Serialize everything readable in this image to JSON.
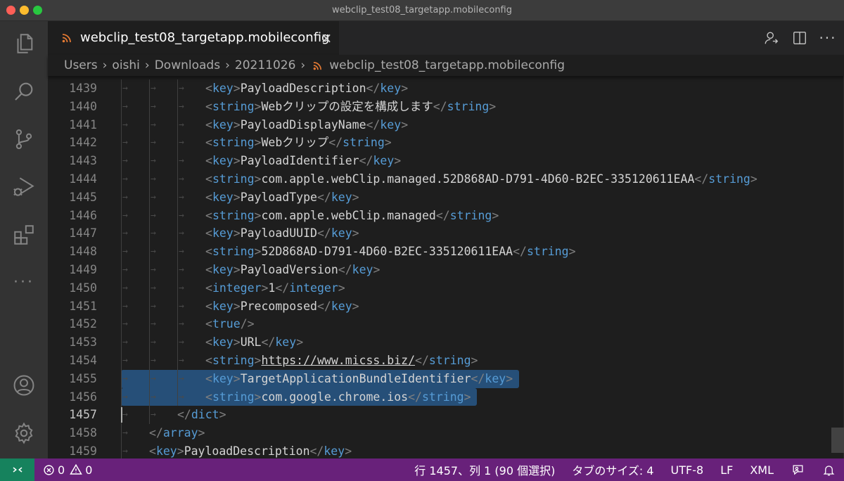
{
  "window": {
    "title": "webclip_test08_targetapp.mobileconfig"
  },
  "activity_bar": {
    "items": [
      {
        "name": "explorer",
        "icon": "files-icon"
      },
      {
        "name": "search",
        "icon": "search-icon"
      },
      {
        "name": "source-control",
        "icon": "source-control-icon"
      },
      {
        "name": "run-and-debug",
        "icon": "run-debug-icon"
      },
      {
        "name": "extensions",
        "icon": "extensions-icon"
      },
      {
        "name": "more",
        "icon": "more-icon"
      },
      {
        "name": "accounts",
        "icon": "account-icon"
      },
      {
        "name": "manage",
        "icon": "gear-icon"
      }
    ]
  },
  "tab": {
    "label": "webclip_test08_targetapp.mobileconfig",
    "close": "×"
  },
  "breadcrumb": [
    "Users",
    "oishi",
    "Downloads",
    "20211026",
    "webclip_test08_targetapp.mobileconfig"
  ],
  "editor": {
    "lines": [
      {
        "n": "1439",
        "indent": 3,
        "seg": [
          [
            "p",
            "<"
          ],
          [
            "t",
            "key"
          ],
          [
            "p",
            ">"
          ],
          [
            "v",
            "PayloadDescription"
          ],
          [
            "p",
            "</"
          ],
          [
            "t",
            "key"
          ],
          [
            "p",
            ">"
          ]
        ]
      },
      {
        "n": "1440",
        "indent": 3,
        "seg": [
          [
            "p",
            "<"
          ],
          [
            "t",
            "string"
          ],
          [
            "p",
            ">"
          ],
          [
            "v",
            "Webクリップの設定を構成します"
          ],
          [
            "p",
            "</"
          ],
          [
            "t",
            "string"
          ],
          [
            "p",
            ">"
          ]
        ]
      },
      {
        "n": "1441",
        "indent": 3,
        "seg": [
          [
            "p",
            "<"
          ],
          [
            "t",
            "key"
          ],
          [
            "p",
            ">"
          ],
          [
            "v",
            "PayloadDisplayName"
          ],
          [
            "p",
            "</"
          ],
          [
            "t",
            "key"
          ],
          [
            "p",
            ">"
          ]
        ]
      },
      {
        "n": "1442",
        "indent": 3,
        "seg": [
          [
            "p",
            "<"
          ],
          [
            "t",
            "string"
          ],
          [
            "p",
            ">"
          ],
          [
            "v",
            "Webクリップ"
          ],
          [
            "p",
            "</"
          ],
          [
            "t",
            "string"
          ],
          [
            "p",
            ">"
          ]
        ]
      },
      {
        "n": "1443",
        "indent": 3,
        "seg": [
          [
            "p",
            "<"
          ],
          [
            "t",
            "key"
          ],
          [
            "p",
            ">"
          ],
          [
            "v",
            "PayloadIdentifier"
          ],
          [
            "p",
            "</"
          ],
          [
            "t",
            "key"
          ],
          [
            "p",
            ">"
          ]
        ]
      },
      {
        "n": "1444",
        "indent": 3,
        "seg": [
          [
            "p",
            "<"
          ],
          [
            "t",
            "string"
          ],
          [
            "p",
            ">"
          ],
          [
            "v",
            "com.apple.webClip.managed.52D868AD-D791-4D60-B2EC-335120611EAA"
          ],
          [
            "p",
            "</"
          ],
          [
            "t",
            "string"
          ],
          [
            "p",
            ">"
          ]
        ]
      },
      {
        "n": "1445",
        "indent": 3,
        "seg": [
          [
            "p",
            "<"
          ],
          [
            "t",
            "key"
          ],
          [
            "p",
            ">"
          ],
          [
            "v",
            "PayloadType"
          ],
          [
            "p",
            "</"
          ],
          [
            "t",
            "key"
          ],
          [
            "p",
            ">"
          ]
        ]
      },
      {
        "n": "1446",
        "indent": 3,
        "seg": [
          [
            "p",
            "<"
          ],
          [
            "t",
            "string"
          ],
          [
            "p",
            ">"
          ],
          [
            "v",
            "com.apple.webClip.managed"
          ],
          [
            "p",
            "</"
          ],
          [
            "t",
            "string"
          ],
          [
            "p",
            ">"
          ]
        ]
      },
      {
        "n": "1447",
        "indent": 3,
        "seg": [
          [
            "p",
            "<"
          ],
          [
            "t",
            "key"
          ],
          [
            "p",
            ">"
          ],
          [
            "v",
            "PayloadUUID"
          ],
          [
            "p",
            "</"
          ],
          [
            "t",
            "key"
          ],
          [
            "p",
            ">"
          ]
        ]
      },
      {
        "n": "1448",
        "indent": 3,
        "seg": [
          [
            "p",
            "<"
          ],
          [
            "t",
            "string"
          ],
          [
            "p",
            ">"
          ],
          [
            "v",
            "52D868AD-D791-4D60-B2EC-335120611EAA"
          ],
          [
            "p",
            "</"
          ],
          [
            "t",
            "string"
          ],
          [
            "p",
            ">"
          ]
        ]
      },
      {
        "n": "1449",
        "indent": 3,
        "seg": [
          [
            "p",
            "<"
          ],
          [
            "t",
            "key"
          ],
          [
            "p",
            ">"
          ],
          [
            "v",
            "PayloadVersion"
          ],
          [
            "p",
            "</"
          ],
          [
            "t",
            "key"
          ],
          [
            "p",
            ">"
          ]
        ]
      },
      {
        "n": "1450",
        "indent": 3,
        "seg": [
          [
            "p",
            "<"
          ],
          [
            "t",
            "integer"
          ],
          [
            "p",
            ">"
          ],
          [
            "v",
            "1"
          ],
          [
            "p",
            "</"
          ],
          [
            "t",
            "integer"
          ],
          [
            "p",
            ">"
          ]
        ]
      },
      {
        "n": "1451",
        "indent": 3,
        "seg": [
          [
            "p",
            "<"
          ],
          [
            "t",
            "key"
          ],
          [
            "p",
            ">"
          ],
          [
            "v",
            "Precomposed"
          ],
          [
            "p",
            "</"
          ],
          [
            "t",
            "key"
          ],
          [
            "p",
            ">"
          ]
        ]
      },
      {
        "n": "1452",
        "indent": 3,
        "seg": [
          [
            "p",
            "<"
          ],
          [
            "t",
            "true"
          ],
          [
            "p",
            "/>"
          ]
        ]
      },
      {
        "n": "1453",
        "indent": 3,
        "seg": [
          [
            "p",
            "<"
          ],
          [
            "t",
            "key"
          ],
          [
            "p",
            ">"
          ],
          [
            "v",
            "URL"
          ],
          [
            "p",
            "</"
          ],
          [
            "t",
            "key"
          ],
          [
            "p",
            ">"
          ]
        ]
      },
      {
        "n": "1454",
        "indent": 3,
        "seg": [
          [
            "p",
            "<"
          ],
          [
            "t",
            "string"
          ],
          [
            "p",
            ">"
          ],
          [
            "u",
            "https://www.micss.biz/"
          ],
          [
            "p",
            "</"
          ],
          [
            "t",
            "string"
          ],
          [
            "p",
            ">"
          ]
        ]
      },
      {
        "n": "1455",
        "indent": 3,
        "selected": true,
        "seg": [
          [
            "p",
            "<"
          ],
          [
            "t",
            "key"
          ],
          [
            "p",
            ">"
          ],
          [
            "v",
            "TargetApplicationBundleIdentifier"
          ],
          [
            "p",
            "</"
          ],
          [
            "t",
            "key"
          ],
          [
            "p",
            ">"
          ]
        ]
      },
      {
        "n": "1456",
        "indent": 3,
        "selected": true,
        "seg": [
          [
            "p",
            "<"
          ],
          [
            "t",
            "string"
          ],
          [
            "p",
            ">"
          ],
          [
            "v",
            "com.google.chrome.ios"
          ],
          [
            "p",
            "</"
          ],
          [
            "t",
            "string"
          ],
          [
            "p",
            ">"
          ]
        ]
      },
      {
        "n": "1457",
        "indent": 2,
        "active": true,
        "seg": [
          [
            "p",
            "</"
          ],
          [
            "t",
            "dict"
          ],
          [
            "p",
            ">"
          ]
        ]
      },
      {
        "n": "1458",
        "indent": 1,
        "seg": [
          [
            "p",
            "</"
          ],
          [
            "t",
            "array"
          ],
          [
            "p",
            ">"
          ]
        ]
      },
      {
        "n": "1459",
        "indent": 1,
        "seg": [
          [
            "p",
            "<"
          ],
          [
            "t",
            "key"
          ],
          [
            "p",
            ">"
          ],
          [
            "v",
            "PayloadDescription"
          ],
          [
            "p",
            "</"
          ],
          [
            "t",
            "key"
          ],
          [
            "p",
            ">"
          ]
        ]
      }
    ]
  },
  "status_bar": {
    "errors": "0",
    "warnings": "0",
    "cursor_position": "行 1457、列 1 (90 個選択)",
    "tab_size": "タブのサイズ: 4",
    "encoding": "UTF-8",
    "eol": "LF",
    "language": "XML"
  },
  "colors": {
    "status_bar": "#68217a",
    "remote": "#16825d",
    "tag": "#569cd6",
    "punctuation": "#808080",
    "text": "#d4d4d4",
    "selection": "#264f78"
  }
}
